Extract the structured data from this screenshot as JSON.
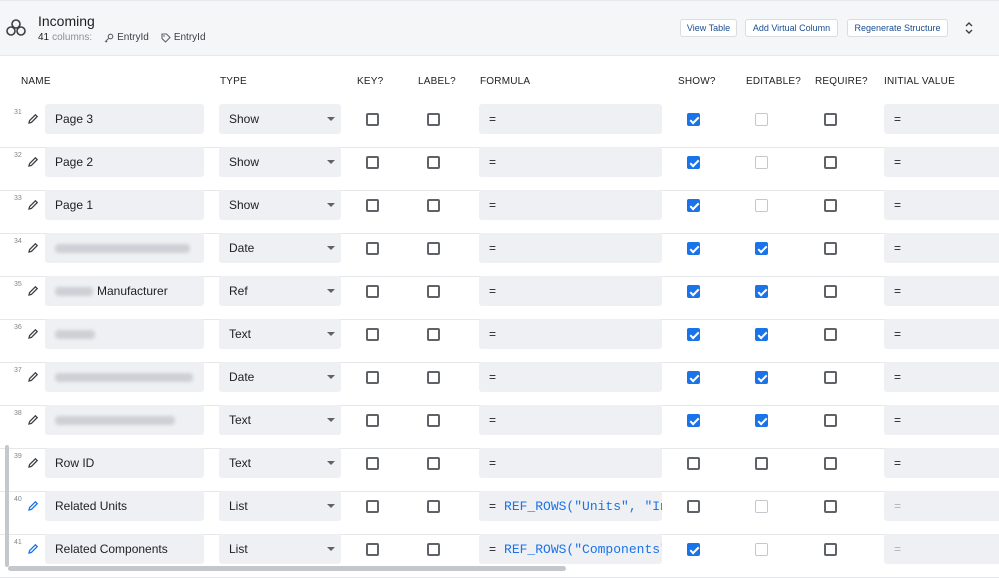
{
  "header": {
    "title": "Incoming",
    "column_count": "41",
    "columns_label": "columns:",
    "key_chip": "EntryId",
    "label_chip": "EntryId",
    "buttons": {
      "view_table": "View Table",
      "add_virtual_column": "Add Virtual Column",
      "regenerate_structure": "Regenerate Structure"
    }
  },
  "columns": {
    "name": "NAME",
    "type": "TYPE",
    "key": "KEY?",
    "label": "LABEL?",
    "formula": "FORMULA",
    "show": "SHOW?",
    "editable": "EDITABLE?",
    "require": "REQUIRE?",
    "initial_value": "INITIAL VALUE"
  },
  "rows": [
    {
      "num": "31",
      "name": "Page 3",
      "type": "Show",
      "key": false,
      "label": false,
      "formula_eq": "=",
      "formula": "",
      "show": true,
      "editable": false,
      "editable_disabled": true,
      "require": false,
      "initial": "=",
      "initial_dim": false
    },
    {
      "num": "32",
      "name": "Page 2",
      "type": "Show",
      "key": false,
      "label": false,
      "formula_eq": "=",
      "formula": "",
      "show": true,
      "editable": false,
      "editable_disabled": true,
      "require": false,
      "initial": "=",
      "initial_dim": false
    },
    {
      "num": "33",
      "name": "Page 1",
      "type": "Show",
      "key": false,
      "label": false,
      "formula_eq": "=",
      "formula": "",
      "show": true,
      "editable": false,
      "editable_disabled": true,
      "require": false,
      "initial": "=",
      "initial_dim": false
    },
    {
      "num": "34",
      "name": "",
      "name_suffix": "",
      "type": "Date",
      "key": false,
      "label": false,
      "formula_eq": "=",
      "formula": "",
      "show": true,
      "editable": true,
      "editable_disabled": false,
      "require": false,
      "initial": "=",
      "initial_dim": false
    },
    {
      "num": "35",
      "name": "Manufacturer",
      "type": "Ref",
      "key": false,
      "label": false,
      "formula_eq": "=",
      "formula": "",
      "show": true,
      "editable": true,
      "editable_disabled": false,
      "require": false,
      "initial": "=",
      "initial_dim": false
    },
    {
      "num": "36",
      "name": "",
      "type": "Text",
      "key": false,
      "label": false,
      "formula_eq": "=",
      "formula": "",
      "show": true,
      "editable": true,
      "editable_disabled": false,
      "require": false,
      "initial": "=",
      "initial_dim": false
    },
    {
      "num": "37",
      "name": "",
      "type": "Date",
      "key": false,
      "label": false,
      "formula_eq": "=",
      "formula": "",
      "show": true,
      "editable": true,
      "editable_disabled": false,
      "require": false,
      "initial": "=",
      "initial_dim": false
    },
    {
      "num": "38",
      "name": "",
      "type": "Text",
      "key": false,
      "label": false,
      "formula_eq": "=",
      "formula": "",
      "show": true,
      "editable": true,
      "editable_disabled": false,
      "require": false,
      "initial": "=",
      "initial_dim": false
    },
    {
      "num": "39",
      "name": "Row ID",
      "type": "Text",
      "key": false,
      "label": false,
      "formula_eq": "=",
      "formula": "",
      "show": false,
      "editable": false,
      "editable_disabled": false,
      "require": false,
      "initial": "=",
      "initial_dim": false
    },
    {
      "num": "40",
      "name": "Related Units",
      "type": "List",
      "key": false,
      "label": false,
      "formula_eq": "=",
      "formula": "REF_ROWS(\"Units\", \"In",
      "show": false,
      "editable": false,
      "editable_disabled": true,
      "require": false,
      "initial": "=",
      "initial_dim": true
    },
    {
      "num": "41",
      "name": "Related Components",
      "type": "List",
      "key": false,
      "label": false,
      "formula_eq": "=",
      "formula": "REF_ROWS(\"Components\"",
      "show": true,
      "editable": false,
      "editable_disabled": true,
      "require": false,
      "initial": "=",
      "initial_dim": true
    }
  ],
  "colors": {
    "accent": "#1a73e8",
    "topbar_bg": "#f5f6f8",
    "field_bg": "#eef0f3",
    "button_text": "#1a4d8f"
  },
  "icons": {
    "logo": "table-logo-icon",
    "key_chip": "key-icon",
    "label_chip": "tag-icon",
    "row_edit": "pencil-icon",
    "sort": "sort-arrows-icon"
  }
}
